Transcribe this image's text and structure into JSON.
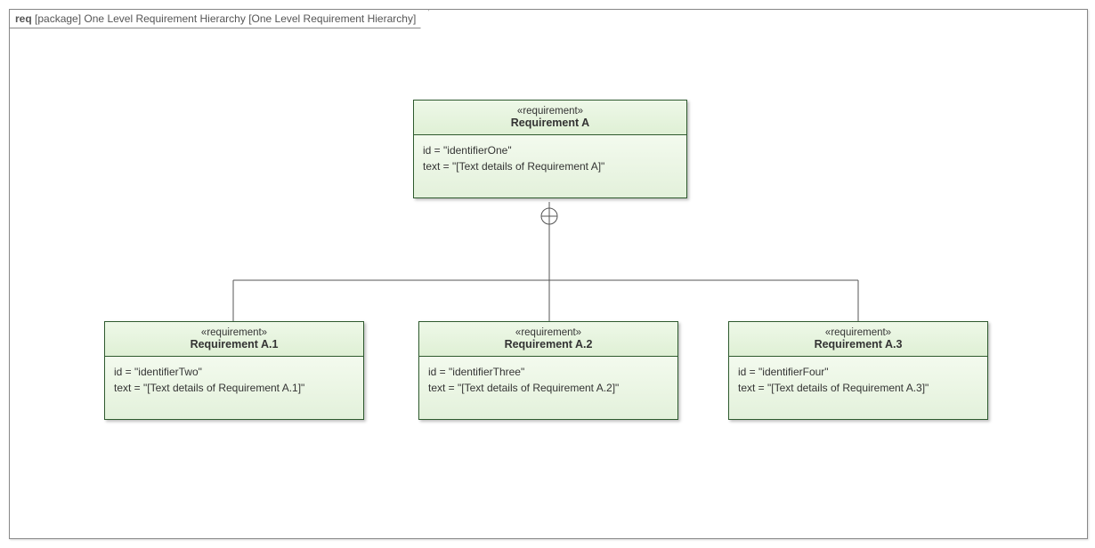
{
  "frame": {
    "kind": "req",
    "type_label": "[package]",
    "title": "One Level Requirement Hierarchy",
    "bracket": "[One Level Requirement Hierarchy]"
  },
  "parent": {
    "stereotype": "«requirement»",
    "name": "Requirement A",
    "id_line": "id = \"identifierOne\"",
    "text_line": "text = \"[Text details of Requirement A]\""
  },
  "children": [
    {
      "stereotype": "«requirement»",
      "name": "Requirement A.1",
      "id_line": "id = \"identifierTwo\"",
      "text_line": "text = \"[Text details of Requirement A.1]\""
    },
    {
      "stereotype": "«requirement»",
      "name": "Requirement A.2",
      "id_line": "id = \"identifierThree\"",
      "text_line": "text = \"[Text details of Requirement A.2]\""
    },
    {
      "stereotype": "«requirement»",
      "name": "Requirement A.3",
      "id_line": "id = \"identifierFour\"",
      "text_line": "text = \"[Text details of Requirement A.3]\""
    }
  ]
}
